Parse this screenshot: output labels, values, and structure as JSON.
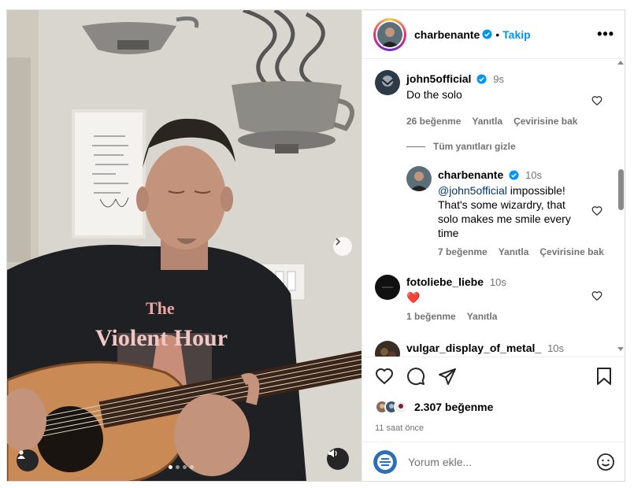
{
  "header": {
    "username": "charbenante",
    "separator": "•",
    "follow_label": "Takip",
    "more_label": "•••"
  },
  "comments": [
    {
      "username": "john5official",
      "verified": true,
      "time": "9s",
      "text": "Do the solo",
      "likes": "26 beğenme",
      "reply": "Yanıtla",
      "translate": "Çevirisine bak"
    },
    {
      "username": "charbenante",
      "verified": true,
      "time": "10s",
      "mention": "@john5official",
      "text_lines": [
        "impossible!",
        "That's some wizardry, that",
        "solo makes me smile every",
        "time"
      ],
      "likes": "7 beğenme",
      "reply": "Yanıtla",
      "translate": "Çevirisine bak"
    },
    {
      "username": "fotoliebe_liebe",
      "time": "10s",
      "text": "❤️",
      "likes": "1 beğenme",
      "reply": "Yanıtla"
    },
    {
      "username": "vulgar_display_of_metal_",
      "time": "10s",
      "text": "🤘🔥"
    }
  ],
  "hide_replies": "Tüm yanıtları gizle",
  "post": {
    "likes": "2.307 beğenme",
    "time_ago": "11 saat önce"
  },
  "add_comment": {
    "placeholder": "Yorum ekle..."
  },
  "media": {
    "shirt_text_line1": "The",
    "shirt_text_line2": "Violent Hour",
    "slides": 4,
    "active_slide": 0
  },
  "colors": {
    "accent": "#0095f6",
    "secondary_text": "#737373",
    "like_red": "#ed4956",
    "verified": "#0095f6"
  }
}
